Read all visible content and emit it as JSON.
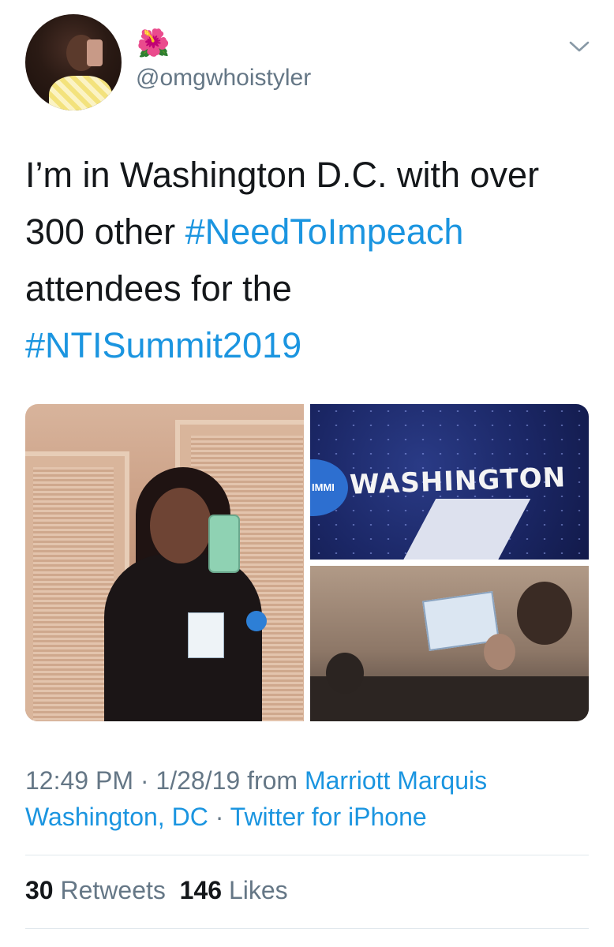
{
  "author": {
    "username": "@omgwhoistyler",
    "name_emoji": "🌺",
    "avatar_icon": "profile-photo"
  },
  "tweet": {
    "text_parts": [
      "I’m in Washington D.C. with over 300 other ",
      "#NeedToImpeach",
      " attendees for the ",
      "#NTISummit2019"
    ],
    "media": {
      "image2_caption": "WASHINGTON",
      "image2_edge_text": "IMMI"
    },
    "time": "12:49 PM",
    "date": "1/28/19",
    "from_label": "from",
    "location": "Marriott Marquis Washington, DC",
    "source": "Twitter for iPhone",
    "separator": "·"
  },
  "stats": {
    "retweets": "30",
    "retweets_label": "Retweets",
    "likes": "146",
    "likes_label": "Likes"
  },
  "colors": {
    "link": "#1b95e0",
    "secondary_text": "#657786",
    "primary_text": "#14171a",
    "divider": "#e1e8ed"
  }
}
